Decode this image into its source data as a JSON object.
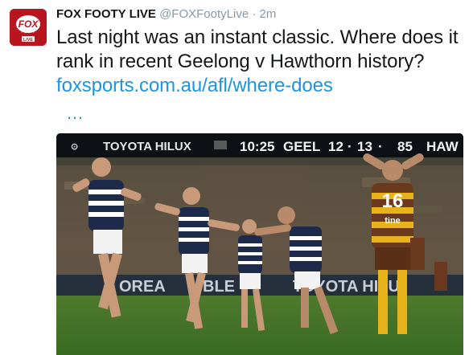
{
  "account": {
    "display_name": "FOX FOOTY LIVE",
    "handle": "@FOXFootyLive",
    "separator": "·",
    "timestamp": "2m",
    "avatar": {
      "logo_top": "FOX",
      "logo_bottom": "FOOTY",
      "logo_live": "LIVE",
      "color": "#b8161f"
    }
  },
  "tweet": {
    "text": "Last night was an instant classic. Where does it rank in recent Geelong v Hawthorn history?",
    "link_text": "foxsports.com.au/afl/where-does",
    "link_ellipsis": "…",
    "link_color": "#1b95e0"
  },
  "media": {
    "scoreboard": {
      "sponsor_left": "TOYOTA HILUX",
      "clock": "10:25",
      "team_home": "GEEL",
      "goals": "12",
      "behinds": "13",
      "total": "85",
      "team_away": "HAW"
    },
    "ad_boards": [
      "OREA",
      "BLE",
      "TOYOTA HILU"
    ],
    "player_number": "16",
    "jersey_text": "tine"
  }
}
